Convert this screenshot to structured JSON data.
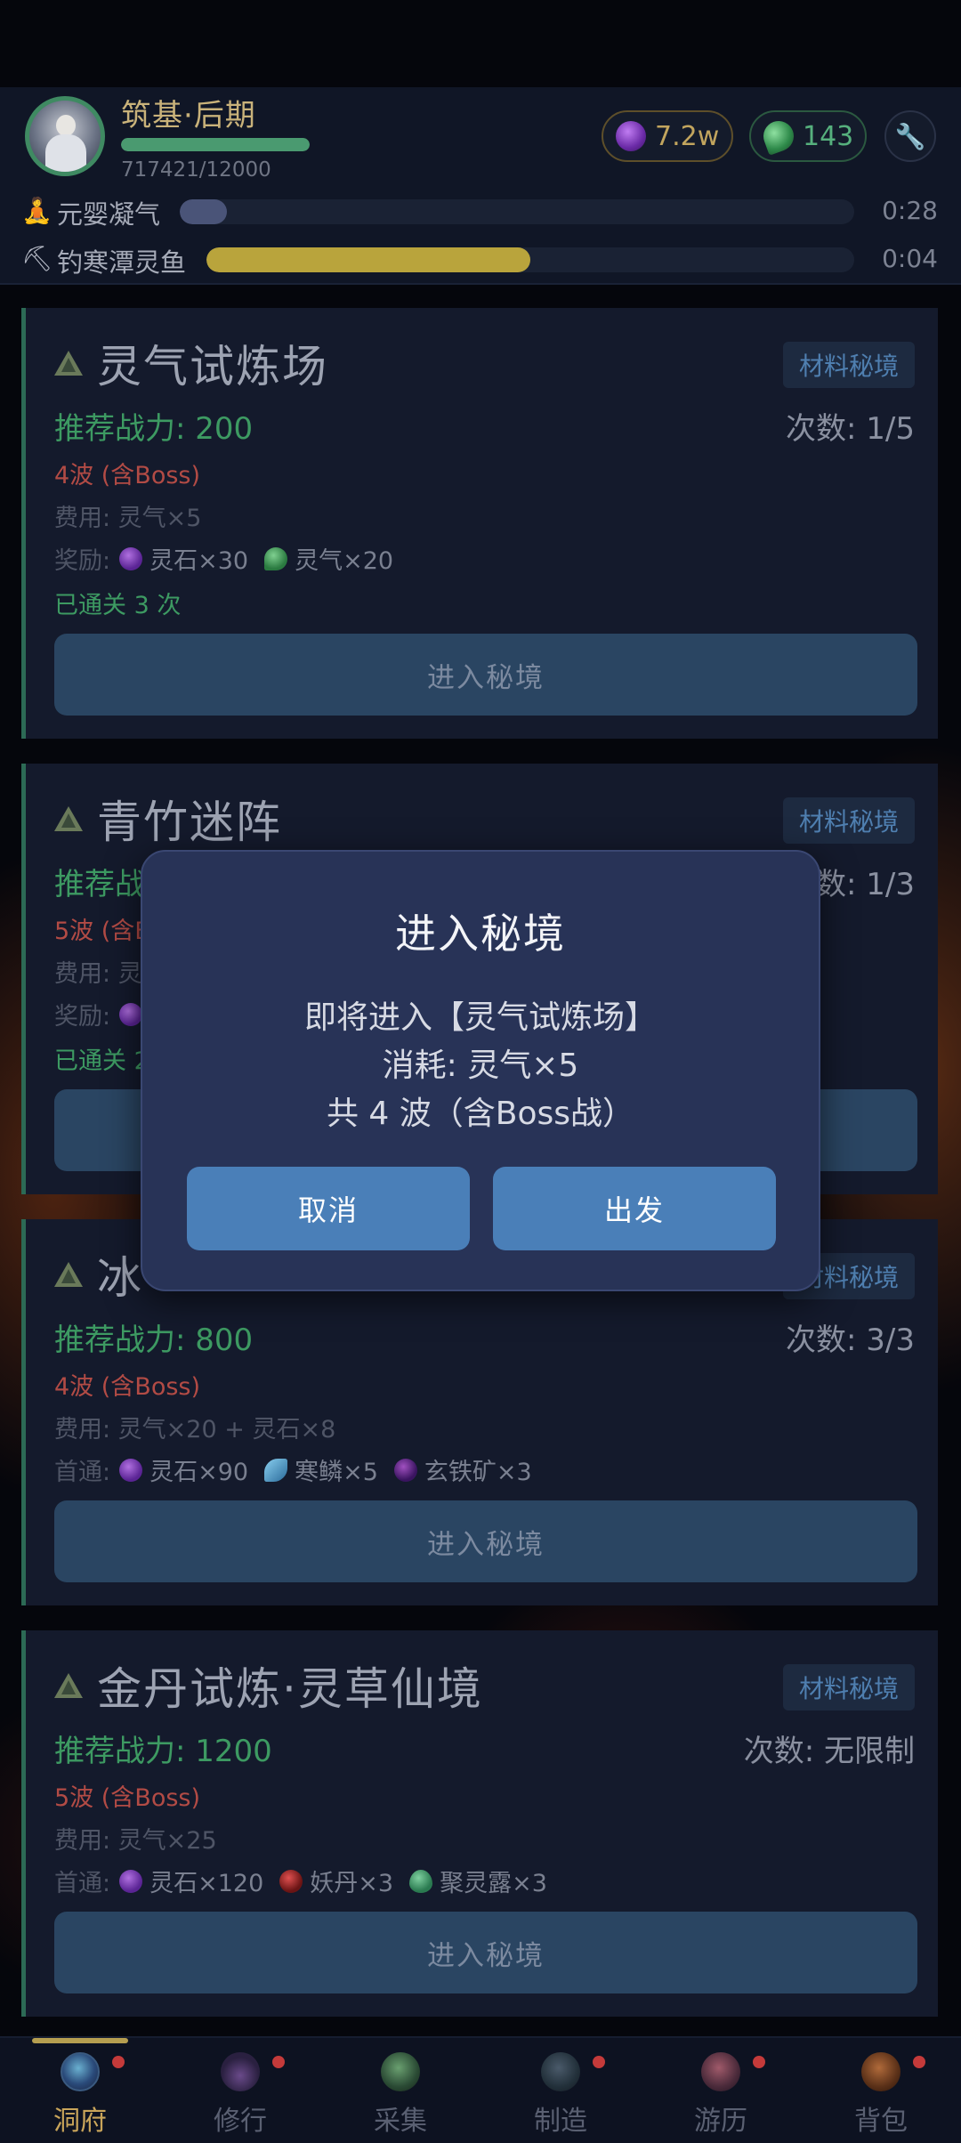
{
  "player": {
    "realm": "筑基·后期",
    "xp_text": "717421/12000",
    "xp_fraction": 1.0
  },
  "currency": {
    "spirit_stone": "7.2w",
    "spirit_qi": "143"
  },
  "tasks": [
    {
      "icon": "meditation-icon",
      "label": "元婴凝气",
      "progress": 0.07,
      "time": "0:28",
      "color": "#4a5478"
    },
    {
      "icon": "pickaxe-icon",
      "label": "钓寒潭灵鱼",
      "progress": 0.5,
      "time": "0:04",
      "color": "#b9a43c"
    }
  ],
  "dungeons": [
    {
      "name": "灵气试炼场",
      "tag": "材料秘境",
      "power": "推荐战力: 200",
      "count": "次数: 1/5",
      "waves": "4波 (含Boss)",
      "cost": "费用: 灵气×5",
      "reward_label": "奖励:",
      "rewards": [
        {
          "icon": "spirit-stone-icon",
          "text": "灵石×30"
        },
        {
          "icon": "spirit-qi-icon",
          "text": "灵气×20"
        }
      ],
      "cleared": "已通关 3 次",
      "button": "进入秘境"
    },
    {
      "name": "青竹迷阵",
      "tag": "材料秘境",
      "power": "推荐战",
      "count": "数: 1/3",
      "waves": "5波 (含B",
      "cost": "费用: 灵",
      "reward_label": "奖励:",
      "rewards": [],
      "cleared": "已通关 2",
      "button": ""
    },
    {
      "name": "冰",
      "tag": "材料秘境",
      "power": "推荐战力: 800",
      "count": "次数: 3/3",
      "waves": "4波 (含Boss)",
      "cost": "费用: 灵气×20 + 灵石×8",
      "reward_label": "首通:",
      "rewards": [
        {
          "icon": "spirit-stone-icon",
          "text": "灵石×90"
        },
        {
          "icon": "cold-scale-icon",
          "text": "寒鳞×5"
        },
        {
          "icon": "dark-iron-icon",
          "text": "玄铁矿×3"
        }
      ],
      "cleared": "",
      "button": "进入秘境"
    },
    {
      "name": "金丹试炼·灵草仙境",
      "tag": "材料秘境",
      "power": "推荐战力: 1200",
      "count": "次数: 无限制",
      "waves": "5波 (含Boss)",
      "cost": "费用: 灵气×25",
      "reward_label": "首通:",
      "rewards": [
        {
          "icon": "spirit-stone-icon",
          "text": "灵石×120"
        },
        {
          "icon": "demon-core-icon",
          "text": "妖丹×3"
        },
        {
          "icon": "spirit-dew-icon",
          "text": "聚灵露×3"
        }
      ],
      "cleared": "",
      "button": "进入秘境"
    }
  ],
  "dialog": {
    "title": "进入秘境",
    "line1": "即将进入【灵气试炼场】",
    "line2": "消耗: 灵气×5",
    "line3": "共 4 波（含Boss战）",
    "cancel": "取消",
    "confirm": "出发"
  },
  "tabs": [
    {
      "label": "洞府",
      "icon": "cave-icon",
      "active": true,
      "badge": true
    },
    {
      "label": "修行",
      "icon": "cultivate-icon",
      "active": false,
      "badge": true
    },
    {
      "label": "采集",
      "icon": "gather-icon",
      "active": false,
      "badge": false
    },
    {
      "label": "制造",
      "icon": "craft-icon",
      "active": false,
      "badge": true
    },
    {
      "label": "游历",
      "icon": "travel-icon",
      "active": false,
      "badge": true
    },
    {
      "label": "背包",
      "icon": "bag-icon",
      "active": false,
      "badge": true
    }
  ],
  "colors": {
    "accent_gold": "#c9a55a",
    "power_green": "#3d9a62",
    "wave_red": "#b24b45",
    "tag_blue": "#4f7fb0",
    "dialog_button": "#4a7fb8"
  }
}
